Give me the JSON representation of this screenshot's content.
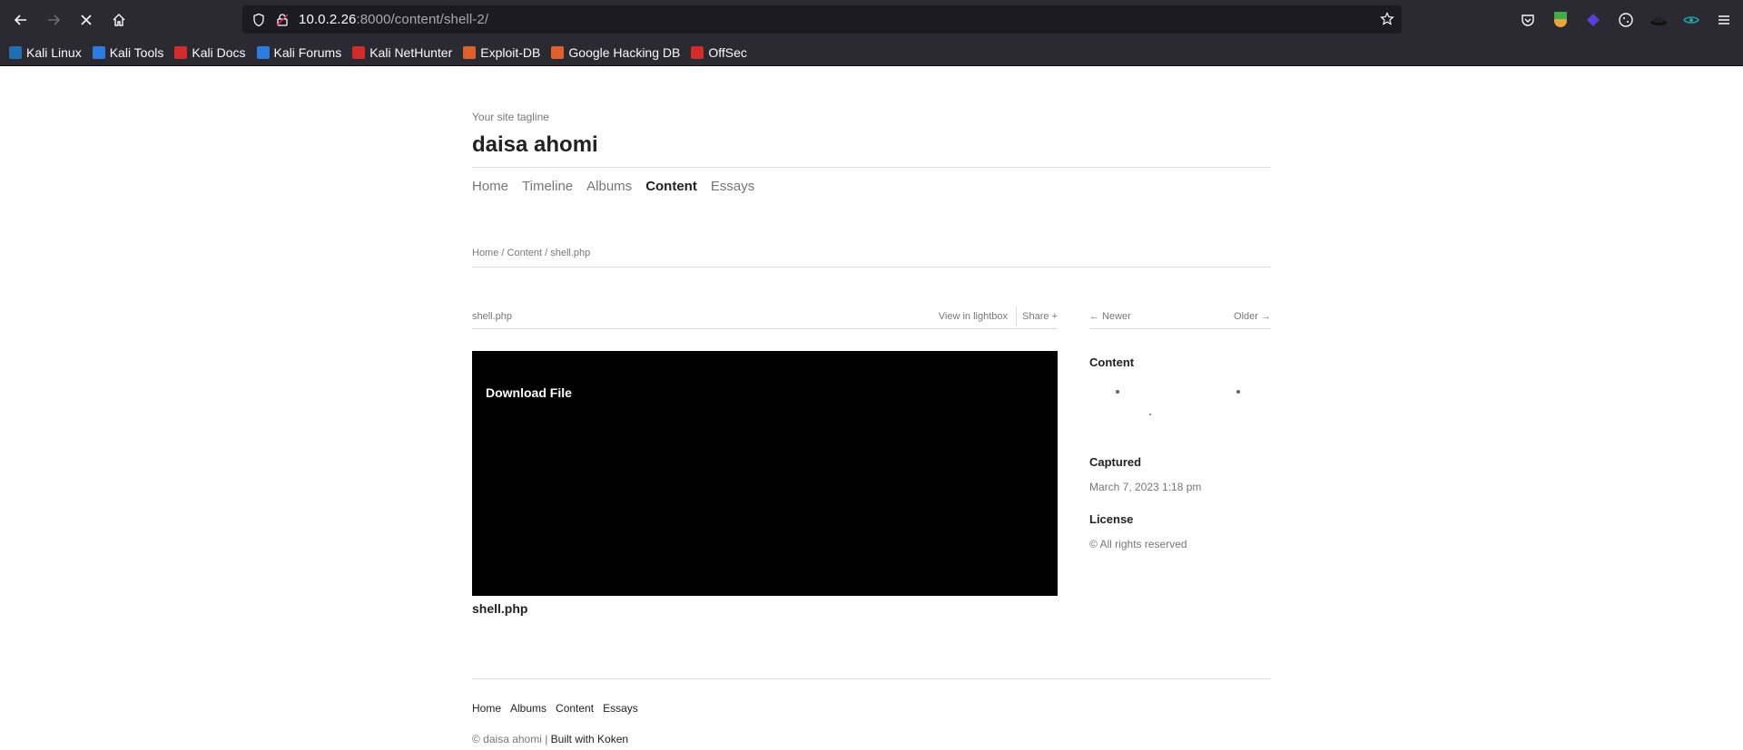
{
  "browser": {
    "url_host": "10.0.2.26",
    "url_path": ":8000/content/shell-2/",
    "bookmarks": [
      {
        "label": "Kali Linux",
        "color": "#1f6fb2"
      },
      {
        "label": "Kali Tools",
        "color": "#2e7be0"
      },
      {
        "label": "Kali Docs",
        "color": "#d22b2b"
      },
      {
        "label": "Kali Forums",
        "color": "#2e7be0"
      },
      {
        "label": "Kali NetHunter",
        "color": "#d22b2b"
      },
      {
        "label": "Exploit-DB",
        "color": "#e0602b"
      },
      {
        "label": "Google Hacking DB",
        "color": "#e0602b"
      },
      {
        "label": "OffSec",
        "color": "#d22b2b"
      }
    ]
  },
  "site": {
    "tagline": "Your site tagline",
    "title": "daisa ahomi",
    "nav": [
      "Home",
      "Timeline",
      "Albums",
      "Content",
      "Essays"
    ],
    "active_nav": "Content"
  },
  "breadcrumb": "Home / Content / shell.php",
  "content": {
    "title": "shell.php",
    "view_lightbox": "View in lightbox",
    "share": "Share +",
    "download": "Download File",
    "caption": "shell.php"
  },
  "pager": {
    "newer": "← Newer",
    "older": "Older →"
  },
  "sidebar": {
    "content_heading": "Content",
    "captured_heading": "Captured",
    "captured_value": "March 7, 2023 1:18 pm",
    "license_heading": "License",
    "license_value": "© All rights reserved"
  },
  "footer": {
    "nav": [
      "Home",
      "Albums",
      "Content",
      "Essays"
    ],
    "credit_prefix": "© daisa ahomi | ",
    "credit_link": "Built with Koken"
  }
}
